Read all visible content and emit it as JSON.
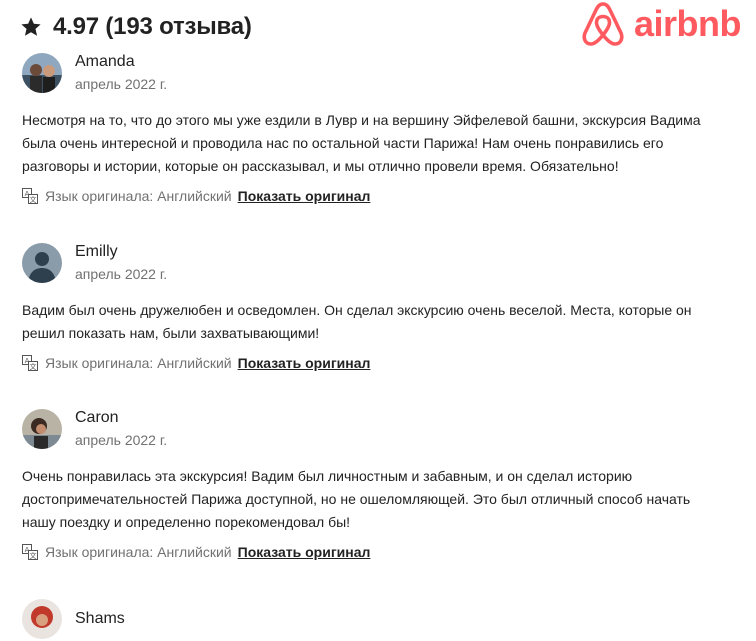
{
  "header": {
    "rating_title": "4.97 (193 отзыва)",
    "star_icon": "star-icon"
  },
  "brand": {
    "logo_text": "airbnb",
    "logo_icon": "airbnb-belo-icon",
    "color": "#FF5A5F"
  },
  "reviews": [
    {
      "name": "Amanda",
      "date": "апрель 2022 г.",
      "text": "Несмотря на то, что до этого мы уже ездили в Лувр и на вершину Эйфелевой башни, экскурсия Вадима была очень интересной и проводила нас по остальной части Парижа! Нам очень понравились его разговоры и истории, которые он рассказывал, и мы отлично провели время. Обязательно!",
      "original_language": "Язык оригинала: Английский",
      "show_original": "Показать оригинал"
    },
    {
      "name": "Emilly",
      "date": "апрель 2022 г.",
      "text": "Вадим был очень дружелюбен и осведомлен. Он сделал экскурсию очень веселой. Места, которые он решил показать нам, были захватывающими!",
      "original_language": "Язык оригинала: Английский",
      "show_original": "Показать оригинал"
    },
    {
      "name": "Caron",
      "date": "апрель 2022 г.",
      "text": "Очень понравилась эта экскурсия! Вадим был личностным и забавным, и он сделал историю достопримечательностей Парижа доступной, но не ошеломляющей. Это был отличный способ начать нашу поездку и определенно порекомендовал бы!",
      "original_language": "Язык оригинала: Английский",
      "show_original": "Показать оригинал"
    },
    {
      "name": "Shams"
    }
  ]
}
